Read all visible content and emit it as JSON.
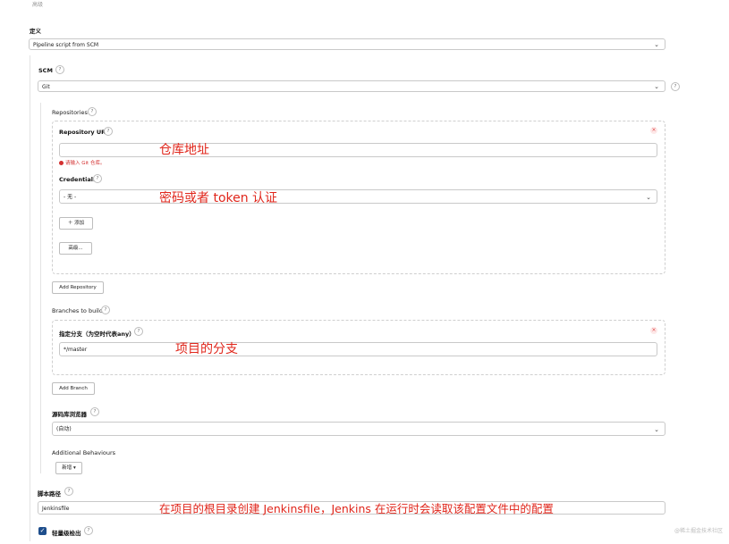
{
  "header": {
    "top_cut_label": "高级"
  },
  "definition": {
    "label": "定义",
    "value": "Pipeline script from SCM"
  },
  "scm": {
    "label": "SCM",
    "value": "Git"
  },
  "repositories": {
    "label": "Repositories",
    "url_label": "Repository URL",
    "url_value": "",
    "error": "请输入 Git 仓库。",
    "credentials_label": "Credentials",
    "credentials_value": "- 无 -",
    "add_button": "添加",
    "advanced_button": "高级...",
    "add_repository_button": "Add Repository"
  },
  "branches": {
    "label": "Branches to build",
    "specifier_label": "指定分支（为空时代表any）",
    "specifier_value": "*/master",
    "add_branch_button": "Add Branch"
  },
  "browser": {
    "label": "源码库浏览器",
    "value": "(自动)"
  },
  "behaviours": {
    "label": "Additional Behaviours",
    "add_button": "新增"
  },
  "script_path": {
    "label": "脚本路径",
    "value": "Jenkinsfile"
  },
  "lightweight": {
    "label": "轻量级检出",
    "checked": true
  },
  "annotations": {
    "repo_url": "仓库地址",
    "credentials": "密码或者 token 认证",
    "branch": "项目的分支",
    "script": "在项目的根目录创建 Jenkinsfile，Jenkins 在运行时会读取该配置文件中的配置"
  },
  "watermark": "@稀土掘金技术社区",
  "colors": {
    "annotation": "#e0261b",
    "checkbox": "#1e4e8c",
    "error": "#d32f2f"
  }
}
